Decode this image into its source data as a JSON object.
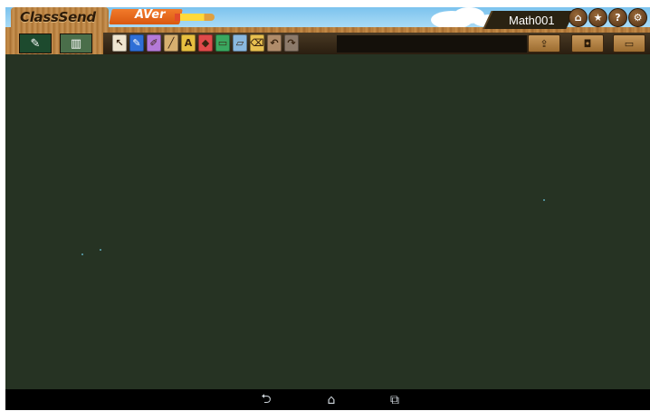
{
  "app": {
    "logo_text": "ClassSend",
    "brand_text": "AVer",
    "class_name": "Math001"
  },
  "header_buttons": [
    {
      "name": "home-icon",
      "glyph": "⌂"
    },
    {
      "name": "star-icon",
      "glyph": "★"
    },
    {
      "name": "help-icon",
      "glyph": "?"
    },
    {
      "name": "settings-icon",
      "glyph": "⚙"
    }
  ],
  "modes": [
    {
      "name": "whiteboard-mode-button",
      "glyph": "✎",
      "active": true
    },
    {
      "name": "split-mode-button",
      "glyph": "▥",
      "active": false
    }
  ],
  "tools": [
    {
      "name": "pointer-tool-icon",
      "glyph": "↖",
      "color": "#f0e6d0"
    },
    {
      "name": "pen-tool-icon",
      "glyph": "✎",
      "color": "#2f6fd6"
    },
    {
      "name": "highlighter-tool-icon",
      "glyph": "✐",
      "color": "#b47ad8"
    },
    {
      "name": "line-tool-icon",
      "glyph": "╱",
      "color": "#d8b070"
    },
    {
      "name": "text-tool-icon",
      "glyph": "A",
      "color": "#e8c040"
    },
    {
      "name": "shape-tool-icon",
      "glyph": "◆",
      "color": "#e04a4a"
    },
    {
      "name": "image-tool-icon",
      "glyph": "▭",
      "color": "#3aa860"
    },
    {
      "name": "eraser-tool-icon",
      "glyph": "▱",
      "color": "#8ab8e0"
    },
    {
      "name": "clear-tool-icon",
      "glyph": "⌫",
      "color": "#e8c050"
    },
    {
      "name": "undo-tool-icon",
      "glyph": "↶",
      "color": "#b08c6a"
    },
    {
      "name": "redo-tool-icon",
      "glyph": "↷",
      "color": "#8c7a6a"
    }
  ],
  "right_tools": [
    {
      "name": "share-icon",
      "glyph": "⇪"
    },
    {
      "name": "camera-icon",
      "glyph": "◘"
    },
    {
      "name": "presenter-icon",
      "glyph": "▭"
    }
  ],
  "navigation": {
    "back": "⮌",
    "home": "⌂",
    "recent": "⧉"
  }
}
